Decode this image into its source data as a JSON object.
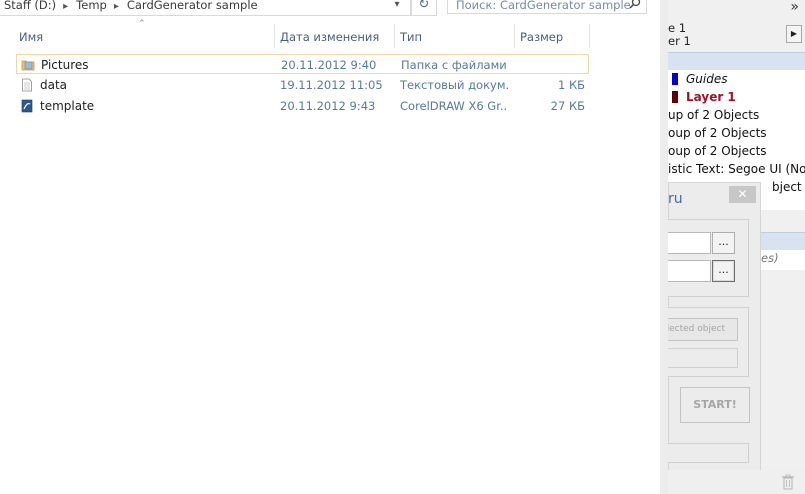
{
  "explorer": {
    "breadcrumb": [
      "Staff (D:)",
      "Temp",
      "CardGenerator sample"
    ],
    "search_placeholder": "Поиск: CardGenerator sample",
    "columns": {
      "name": "Имя",
      "date": "Дата изменения",
      "type": "Тип",
      "size": "Размер"
    },
    "files": [
      {
        "name": "Pictures",
        "date": "20.11.2012 9:40",
        "type": "Папка с файлами",
        "size": "",
        "icon": "folder-icon"
      },
      {
        "name": "data",
        "date": "19.11.2012 11:05",
        "type": "Текстовый докум...",
        "size": "1 КБ",
        "icon": "text-file-icon"
      },
      {
        "name": "template",
        "date": "20.11.2012 9:43",
        "type": "CorelDRAW X6 Gr...",
        "size": "27 КБ",
        "icon": "coreldraw-file-icon"
      }
    ]
  },
  "docker": {
    "page_label": "e 1",
    "layer_label": "er 1",
    "tree": [
      {
        "text": "Guides",
        "style": "italic",
        "swatch": "#0000cc"
      },
      {
        "text": "Layer 1",
        "style": "bold",
        "swatch": "#5a0000",
        "color": "#a0142a"
      },
      {
        "text": "up of 2 Objects"
      },
      {
        "text": "oup of 2 Objects"
      },
      {
        "text": "oup of 2 Objects"
      },
      {
        "text": "istic Text: Segoe UI (Norm"
      },
      {
        "text": "bject"
      }
    ],
    "lower_italic": "es)",
    "dialog": {
      "title": "ru",
      "close": "✕",
      "browse_label": "...",
      "selected_object_button": "elected object",
      "start_button": "START!"
    }
  }
}
